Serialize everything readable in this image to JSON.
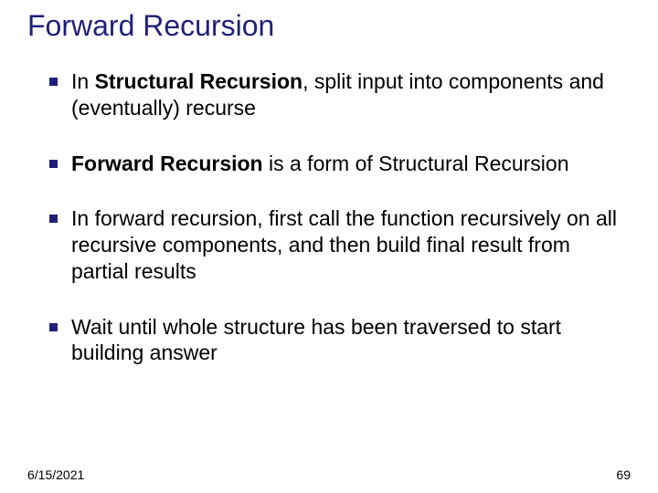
{
  "title": "Forward Recursion",
  "bullets": {
    "b1_pre": "In ",
    "b1_bold": "Structural Recursion",
    "b1_post": ", split input into components and (eventually) recurse",
    "b2_bold": "Forward Recursion",
    "b2_post": " is a form of Structural Recursion",
    "b3": "In forward recursion, first call the function recursively on all recursive components, and then build final result from partial results",
    "b4": "Wait until whole structure has been traversed to start building answer"
  },
  "footer": {
    "date": "6/15/2021",
    "page": "69"
  }
}
